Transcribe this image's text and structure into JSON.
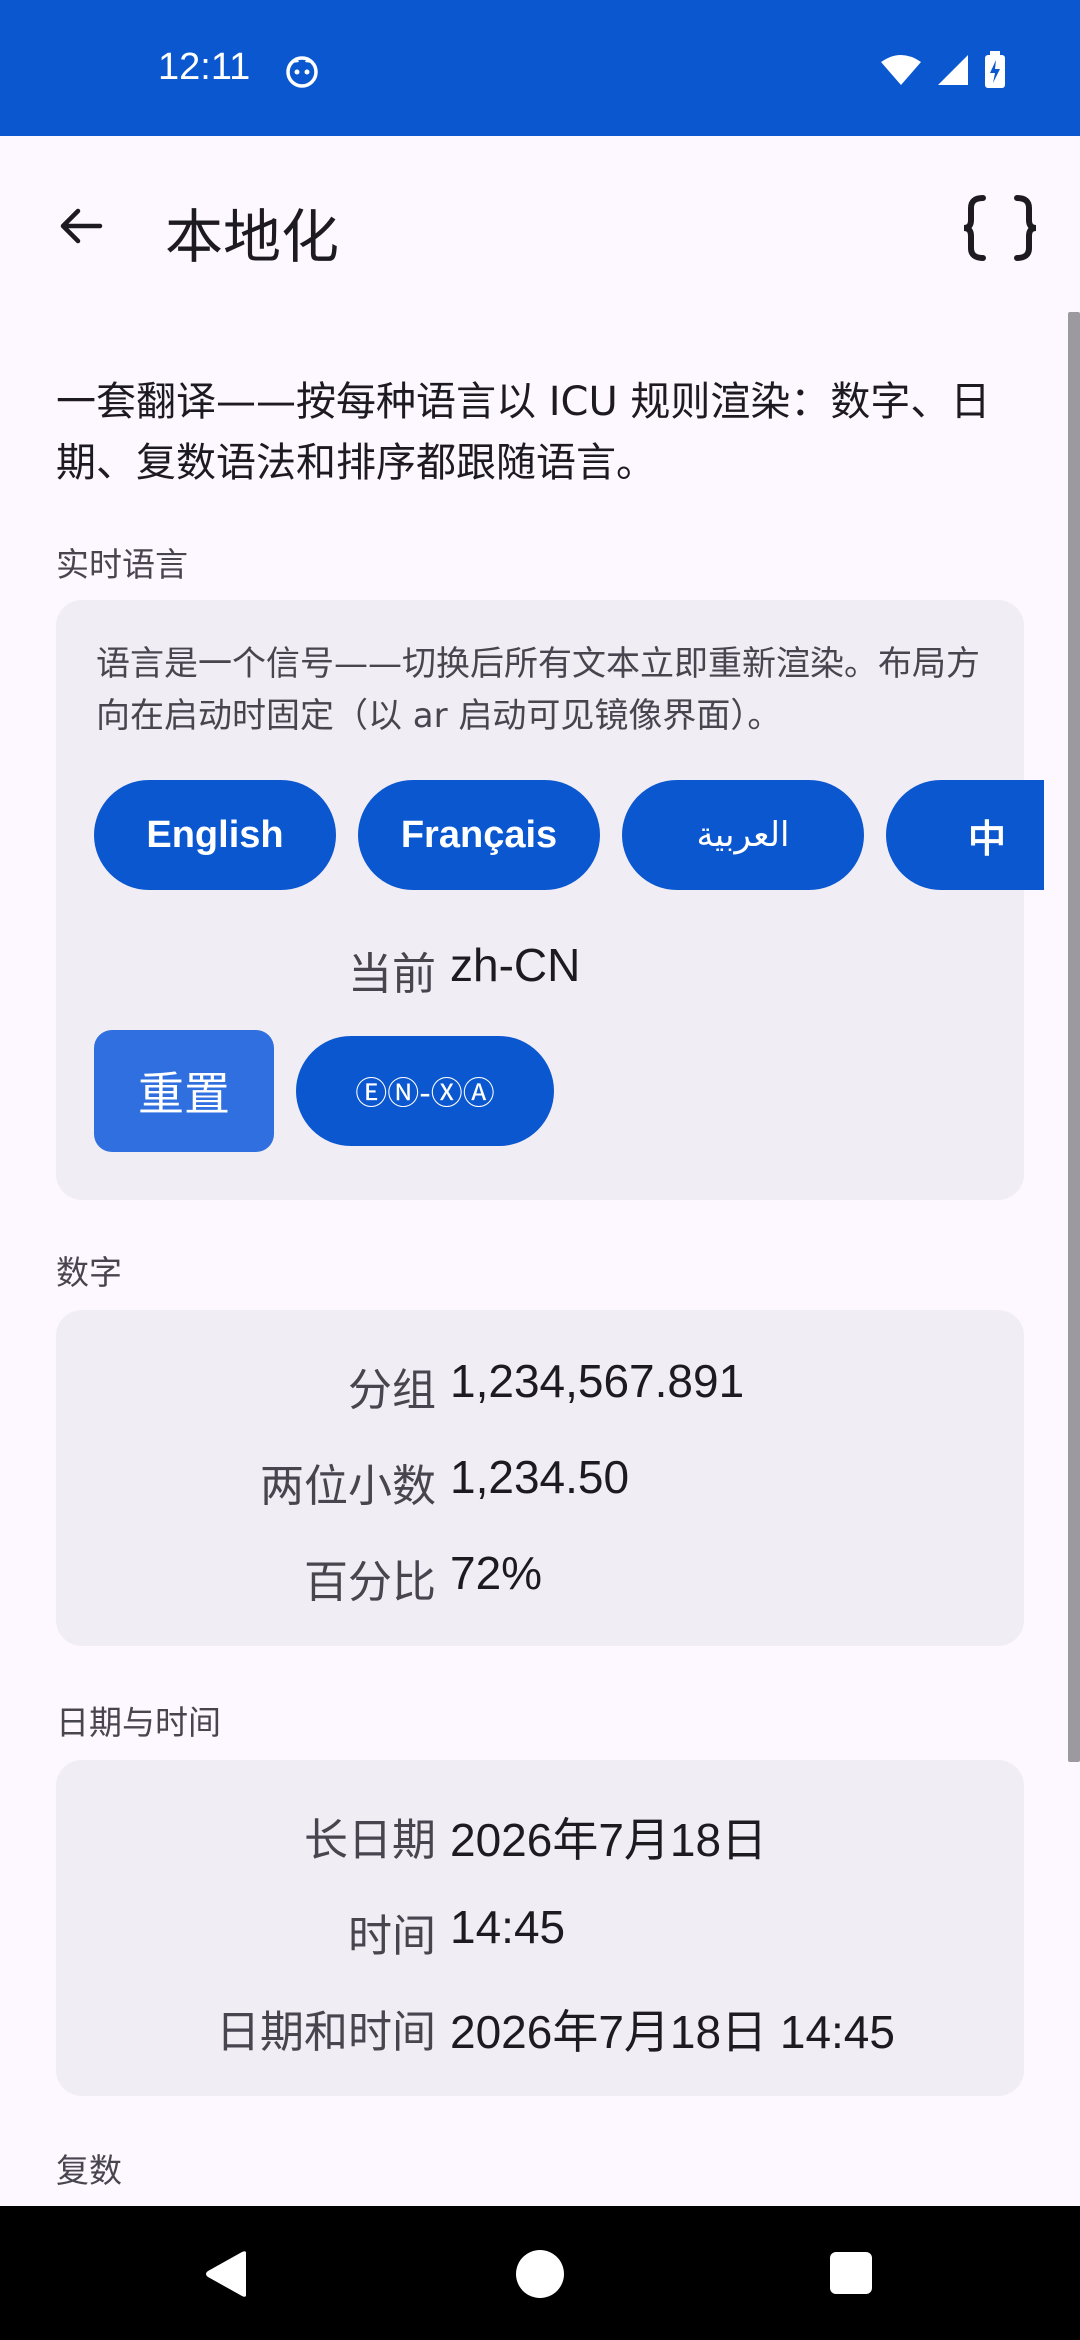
{
  "status_bar": {
    "time": "12:11",
    "icons": [
      "cat-notification-icon",
      "wifi-icon",
      "signal-icon",
      "battery-charging-icon"
    ]
  },
  "app_bar": {
    "title": "本地化",
    "back_icon": "arrow-back-icon",
    "action_icon": "braces-icon"
  },
  "intro": "一套翻译——按每种语言以 ICU 规则渲染：数字、日期、复数语法和排序都跟随语言。",
  "live_locale": {
    "section_label": "实时语言",
    "note": "语言是一个信号——切换后所有文本立即重新渲染。布局方向在启动时固定（以 ar 启动可见镜像界面）。",
    "languages": [
      "English",
      "Français",
      "العربية",
      "中"
    ],
    "current_label": "当前",
    "current_value": "zh-CN",
    "reset_label": "重置",
    "pseudo_label": "ⒺⓃ-ⓍⒶ"
  },
  "numbers": {
    "section_label": "数字",
    "rows": [
      {
        "label": "分组",
        "value": "1,234,567.891"
      },
      {
        "label": "两位小数",
        "value": "1,234.50"
      },
      {
        "label": "百分比",
        "value": "72%"
      }
    ]
  },
  "datetime": {
    "section_label": "日期与时间",
    "rows": [
      {
        "label": "长日期",
        "value": "2026年7月18日"
      },
      {
        "label": "时间",
        "value": "14:45"
      },
      {
        "label": "日期和时间",
        "value": "2026年7月18日 14:45"
      }
    ]
  },
  "plurals": {
    "section_label": "复数"
  },
  "nav_bar": {
    "icons": [
      "nav-back-icon",
      "nav-home-icon",
      "nav-recents-icon"
    ]
  },
  "colors": {
    "primary": "#0b57d0",
    "reset_button": "#2f6fe0",
    "card_background": "#f1edf4",
    "page_background": "#fdf7ff"
  }
}
